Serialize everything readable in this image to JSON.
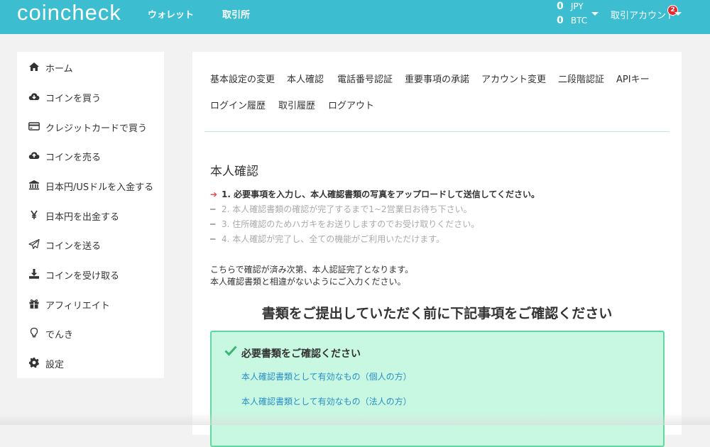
{
  "header": {
    "logo": "coincheck",
    "nav": [
      "ウォレット",
      "取引所"
    ],
    "balances": [
      {
        "amount": "0",
        "currency": "JPY"
      },
      {
        "amount": "0",
        "currency": "BTC"
      }
    ],
    "account_label": "取引アカウント",
    "notification_count": "2",
    "colors": {
      "bar": "#3cbdd0",
      "badge": "#e8292e"
    }
  },
  "sidebar": {
    "items": [
      {
        "label": "ホーム",
        "icon": "home-icon"
      },
      {
        "label": "コインを買う",
        "icon": "cloud-download-icon"
      },
      {
        "label": "クレジットカードで買う",
        "icon": "credit-card-icon"
      },
      {
        "label": "コインを売る",
        "icon": "cloud-upload-icon"
      },
      {
        "label": "日本円/USドルを入金する",
        "icon": "bank-icon"
      },
      {
        "label": "日本円を出金する",
        "icon": "yen-icon"
      },
      {
        "label": "コインを送る",
        "icon": "paper-plane-icon"
      },
      {
        "label": "コインを受け取る",
        "icon": "download-tray-icon"
      },
      {
        "label": "アフィリエイト",
        "icon": "gift-icon"
      },
      {
        "label": "でんき",
        "icon": "lightbulb-icon"
      },
      {
        "label": "設定",
        "icon": "gear-icon"
      }
    ]
  },
  "main": {
    "tabs": [
      "基本設定の変更",
      "本人確認",
      "電話番号認証",
      "重要事項の承諾",
      "アカウント変更",
      "二段階認証",
      "APIキー",
      "ログイン履歴",
      "取引履歴",
      "ログアウト"
    ],
    "section_title": "本人確認",
    "steps": [
      {
        "text": "1. 必要事項を入力し、本人確認書類の写真をアップロードして送信してください。",
        "state": "active"
      },
      {
        "text": "2. 本人確認書類の確認が完了するまで1~2営業日お待ち下さい。",
        "state": "inactive"
      },
      {
        "text": "3. 住所確認のためハガキをお送りしますのでお受け取りください。",
        "state": "inactive"
      },
      {
        "text": "4. 本人確認が完了し、全ての機能がご利用いただけます。",
        "state": "inactive"
      }
    ],
    "notes": [
      "こちらで確認が済み次第、本人認証完了となります。",
      "本人確認書類と相違がないようにご入力ください。"
    ],
    "notice_heading": "書類をご提出していただく前に下記事項をご確認ください",
    "checklist": {
      "title": "必要書類をご確認ください",
      "links": [
        "本人確認書類として有効なもの（個人の方）",
        "本人確認書類として有効なもの（法人の方）"
      ],
      "colors": {
        "bg": "#c8f7e2",
        "border": "#5fd99f",
        "check": "#3cb371",
        "link": "#2a8fc5"
      }
    }
  }
}
